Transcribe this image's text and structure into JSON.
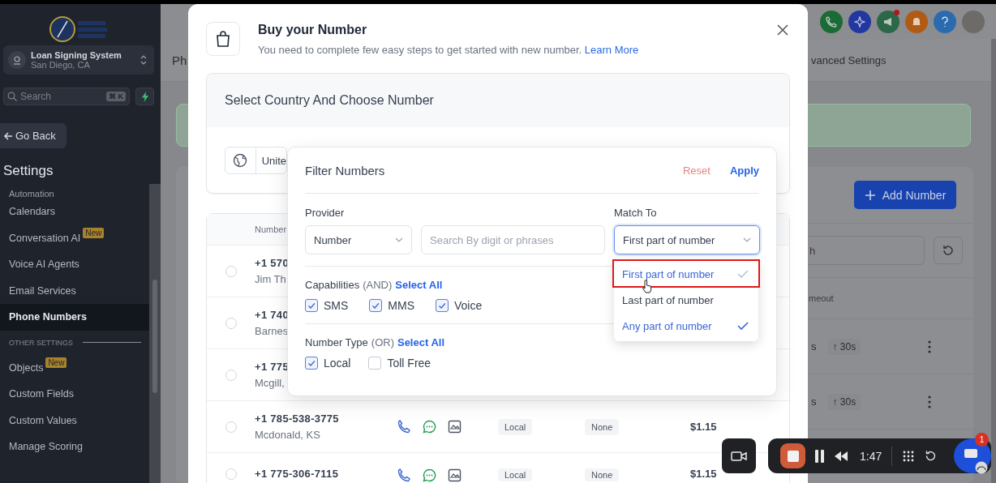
{
  "sidebar": {
    "account": {
      "name": "Loan Signing System",
      "location": "San Diego, CA"
    },
    "search": {
      "placeholder": "Search",
      "shortcut": "⌘ K"
    },
    "back_button": "Go Back",
    "heading": "Settings",
    "items": [
      {
        "label": "Automation",
        "selected": false
      },
      {
        "label": "Calendars",
        "selected": false
      },
      {
        "label": "Conversation AI",
        "badge": "New",
        "selected": false
      },
      {
        "label": "Voice AI Agents",
        "selected": false
      },
      {
        "label": "Email Services",
        "selected": false
      },
      {
        "label": "Phone Numbers",
        "selected": true
      }
    ],
    "other_heading": "OTHER SETTINGS",
    "other_items": [
      {
        "label": "Objects",
        "badge": "New",
        "selected": false
      },
      {
        "label": "Custom Fields",
        "selected": false
      },
      {
        "label": "Custom Values",
        "selected": false
      },
      {
        "label": "Manage Scoring",
        "selected": false
      }
    ]
  },
  "page": {
    "title": "Ph",
    "tab": "vanced Settings",
    "add_button": "Add Number",
    "search_value": "h",
    "column": "meout",
    "rows": [
      {
        "column_1": "s",
        "column_2": "↑ 30s"
      },
      {
        "column_1": "s",
        "column_2": "↑ 30s"
      }
    ]
  },
  "modal": {
    "title": "Buy your Number",
    "subtitle": "You need to complete few easy steps to get started with new number.",
    "link": "Learn More",
    "section_title": "Select Country And Choose Number",
    "country": "Unite",
    "table": {
      "columns": [
        "Number"
      ],
      "rows": [
        {
          "number": "+1 570",
          "location": "Jim Th",
          "selected": false
        },
        {
          "number": "+1 740",
          "location": "Barnes",
          "selected": false
        },
        {
          "number": "+1 775",
          "location": "Mcgill,",
          "selected": false
        },
        {
          "number": "+1 785-538-3775",
          "location": "Mcdonald, KS",
          "type": "Local",
          "column_5": "None",
          "price": "$1.15",
          "selected": false
        },
        {
          "number": "+1 775-306-7115",
          "type": "Local",
          "column_5": "None",
          "price": "$1.15",
          "selected": false
        }
      ]
    }
  },
  "filter": {
    "title": "Filter Numbers",
    "reset": "Reset",
    "apply": "Apply",
    "provider_label": "Provider",
    "provider": "Number",
    "search_placeholder": "Search By digit or phrases",
    "match_label": "Match To",
    "match_value": "First part of number",
    "match_options": [
      {
        "label": "First part of number",
        "selected": false,
        "highlighted": true
      },
      {
        "label": "Last part of number",
        "selected": false,
        "highlighted": false
      },
      {
        "label": "Any part of number",
        "selected": true,
        "highlighted": false
      }
    ],
    "capabilities": {
      "label": "Capabilities",
      "qualifier": "(AND)",
      "select_all": "Select All",
      "options": [
        {
          "label": "SMS",
          "checked": true
        },
        {
          "label": "MMS",
          "checked": true
        },
        {
          "label": "Voice",
          "checked": true
        }
      ]
    },
    "number_type": {
      "label": "Number Type",
      "qualifier": "(OR)",
      "select_all": "Select All",
      "options": [
        {
          "label": "Local",
          "checked": true
        },
        {
          "label": "Toll Free",
          "checked": false
        }
      ]
    }
  },
  "recorder": {
    "time": "1:47",
    "badge": "1"
  }
}
